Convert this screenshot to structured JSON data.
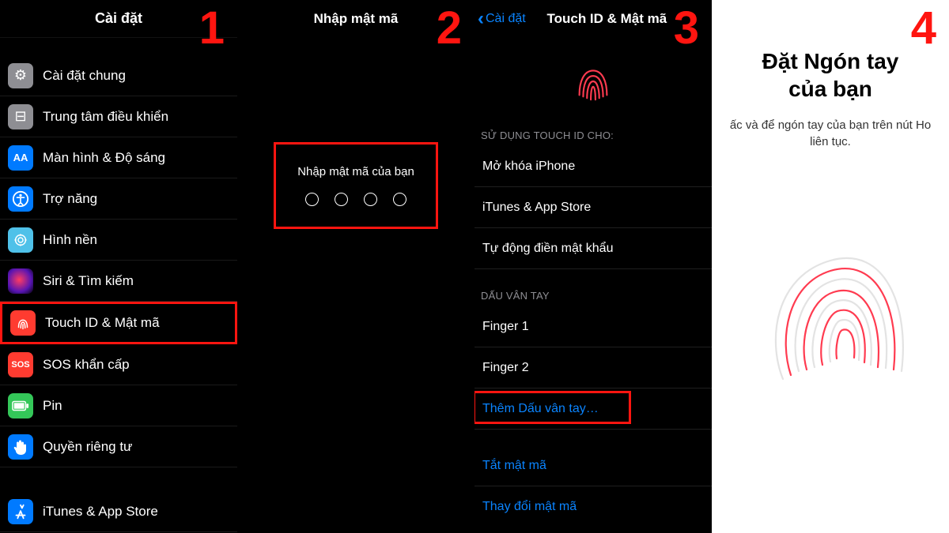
{
  "steps": {
    "s1": "1",
    "s2": "2",
    "s3": "3",
    "s4": "4"
  },
  "panel1": {
    "title": "Cài đặt",
    "rows": {
      "general": "Cài đặt chung",
      "control_center": "Trung tâm điều khiển",
      "display": "Màn hình & Độ sáng",
      "accessibility": "Trợ năng",
      "wallpaper": "Hình nền",
      "siri": "Siri & Tìm kiếm",
      "touchid": "Touch ID & Mật mã",
      "sos": "SOS khẩn cấp",
      "battery": "Pin",
      "privacy": "Quyền riêng tư",
      "appstore": "iTunes & App Store",
      "sos_badge": "SOS"
    }
  },
  "panel2": {
    "title": "Nhập mật mã",
    "prompt": "Nhập mật mã của bạn"
  },
  "panel3": {
    "back": "Cài đặt",
    "title": "Touch ID & Mật mã",
    "section_use": "SỬ DỤNG TOUCH ID CHO:",
    "unlock": "Mở khóa iPhone",
    "itunes": "iTunes & App Store",
    "autofill": "Tự động điền mật khẩu",
    "section_fp": "DẤU VÂN TAY",
    "finger1": "Finger 1",
    "finger2": "Finger 2",
    "add": "Thêm Dấu vân tay…",
    "turnoff": "Tắt mật mã",
    "change": "Thay đổi mật mã"
  },
  "panel4": {
    "title_l1": "Đặt Ngón tay",
    "title_l2": "của bạn",
    "sub_l1": "ấc và để ngón tay của bạn trên nút Ho",
    "sub_l2": "liên tục."
  }
}
